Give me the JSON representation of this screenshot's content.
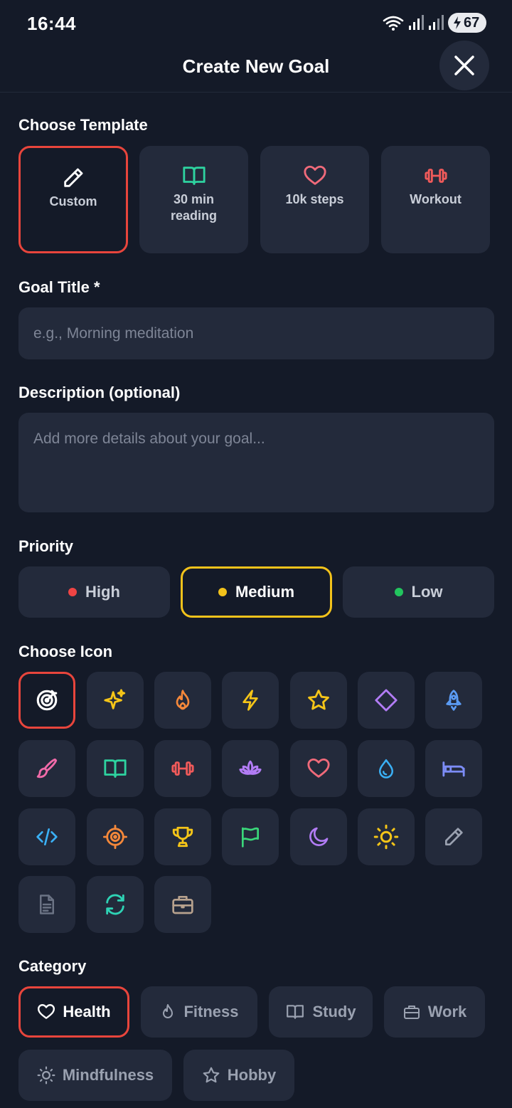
{
  "status": {
    "time": "16:44",
    "battery": "67"
  },
  "header": {
    "title": "Create New Goal"
  },
  "templates": {
    "label": "Choose Template",
    "items": [
      {
        "label": "Custom",
        "icon": "pencil-icon",
        "color": "#ffffff"
      },
      {
        "label": "30 min\nreading",
        "icon": "book-icon",
        "color": "#2ed3a0"
      },
      {
        "label": "10k steps",
        "icon": "heart-icon",
        "color": "#f06a7a"
      },
      {
        "label": "Workout",
        "icon": "dumbbell-icon",
        "color": "#f05a5a"
      }
    ]
  },
  "goal_title": {
    "label": "Goal Title *",
    "placeholder": "e.g., Morning meditation"
  },
  "description": {
    "label": "Description (optional)",
    "placeholder": "Add more details about your goal..."
  },
  "priority": {
    "label": "Priority",
    "items": [
      {
        "label": "High",
        "color": "#ef4444"
      },
      {
        "label": "Medium",
        "color": "#f2c21b"
      },
      {
        "label": "Low",
        "color": "#22c55e"
      }
    ]
  },
  "icons": {
    "label": "Choose Icon",
    "items": [
      {
        "icon": "target-icon",
        "color": "#ffffff"
      },
      {
        "icon": "sparkles-icon",
        "color": "#f5c518"
      },
      {
        "icon": "flame-icon",
        "color": "#f5883a"
      },
      {
        "icon": "lightning-icon",
        "color": "#f5c518"
      },
      {
        "icon": "star-icon",
        "color": "#f5c518"
      },
      {
        "icon": "diamond-icon",
        "color": "#b27cf5"
      },
      {
        "icon": "rocket-icon",
        "color": "#5b9cf5"
      },
      {
        "icon": "paintbrush-icon",
        "color": "#f06aa8"
      },
      {
        "icon": "book-icon",
        "color": "#2ed3a0"
      },
      {
        "icon": "dumbbell-icon",
        "color": "#f05a5a"
      },
      {
        "icon": "lotus-icon",
        "color": "#b27cf5"
      },
      {
        "icon": "heart-icon",
        "color": "#f06a7a"
      },
      {
        "icon": "droplet-icon",
        "color": "#3ab0f5"
      },
      {
        "icon": "bed-icon",
        "color": "#7c8cf5"
      },
      {
        "icon": "code-icon",
        "color": "#3ab0f5"
      },
      {
        "icon": "crosshair-icon",
        "color": "#f5883a"
      },
      {
        "icon": "trophy-icon",
        "color": "#f5c518"
      },
      {
        "icon": "flag-icon",
        "color": "#3ad77a"
      },
      {
        "icon": "moon-icon",
        "color": "#b27cf5"
      },
      {
        "icon": "sun-icon",
        "color": "#f5c518"
      },
      {
        "icon": "pencil-icon",
        "color": "#9aa1b0"
      },
      {
        "icon": "document-icon",
        "color": "#6b7384"
      },
      {
        "icon": "refresh-icon",
        "color": "#2ed3b5"
      },
      {
        "icon": "briefcase-icon",
        "color": "#b8a28e"
      }
    ]
  },
  "category": {
    "label": "Category",
    "items": [
      {
        "label": "Health",
        "icon": "heart-icon"
      },
      {
        "label": "Fitness",
        "icon": "flame-icon"
      },
      {
        "label": "Study",
        "icon": "book-icon"
      },
      {
        "label": "Work",
        "icon": "briefcase-icon"
      },
      {
        "label": "Mindfulness",
        "icon": "sun-icon"
      },
      {
        "label": "Hobby",
        "icon": "star-icon"
      }
    ]
  }
}
